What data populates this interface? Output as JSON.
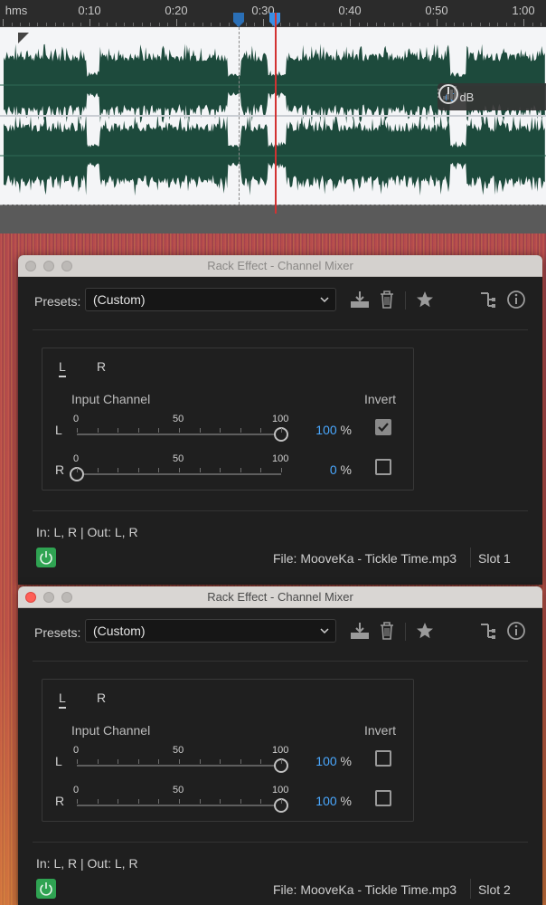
{
  "timeline": {
    "unit_label": "hms",
    "ticks": [
      {
        "label": "0:10"
      },
      {
        "label": "0:20"
      },
      {
        "label": "0:30"
      },
      {
        "label": "0:40"
      },
      {
        "label": "0:50"
      },
      {
        "label": "1:00"
      }
    ],
    "gain_hud": {
      "value": "+0",
      "unit": "dB"
    }
  },
  "panels": [
    {
      "window_title": "Rack Effect - Channel Mixer",
      "active": false,
      "presets_label": "Presets:",
      "preset_value": "(Custom)",
      "tabs": [
        "L",
        "R"
      ],
      "input_channel_label": "Input Channel",
      "invert_label": "Invert",
      "channels": [
        {
          "label": "L",
          "scale_min": "0",
          "scale_mid": "50",
          "scale_max": "100",
          "value": "100",
          "unit": "%",
          "level": 100,
          "invert": true
        },
        {
          "label": "R",
          "scale_min": "0",
          "scale_mid": "50",
          "scale_max": "100",
          "value": "0",
          "unit": "%",
          "level": 0,
          "invert": false
        }
      ],
      "io_label": "In: L, R | Out: L, R",
      "file_label": "File: MooveKa - Tickle Time.mp3",
      "slot_label": "Slot 1"
    },
    {
      "window_title": "Rack Effect - Channel Mixer",
      "active": true,
      "presets_label": "Presets:",
      "preset_value": "(Custom)",
      "tabs": [
        "L",
        "R"
      ],
      "input_channel_label": "Input Channel",
      "invert_label": "Invert",
      "channels": [
        {
          "label": "L",
          "scale_min": "0",
          "scale_mid": "50",
          "scale_max": "100",
          "value": "100",
          "unit": "%",
          "level": 100,
          "invert": false
        },
        {
          "label": "R",
          "scale_min": "0",
          "scale_mid": "50",
          "scale_max": "100",
          "value": "100",
          "unit": "%",
          "level": 100,
          "invert": false
        }
      ],
      "io_label": "In: L, R | Out: L, R",
      "file_label": "File: MooveKa - Tickle Time.mp3",
      "slot_label": "Slot 2"
    }
  ],
  "colors": {
    "accent_value": "#4aa8ff",
    "power_on": "#2fa352",
    "playhead": "#d23232",
    "waveform": "#1d4a3c"
  },
  "icons": [
    "save-preset-icon",
    "delete-preset-icon",
    "favorite-star-icon",
    "routing-icon",
    "info-icon",
    "power-icon",
    "chevron-down-icon",
    "signal-meter-icon",
    "gain-knob-icon"
  ]
}
